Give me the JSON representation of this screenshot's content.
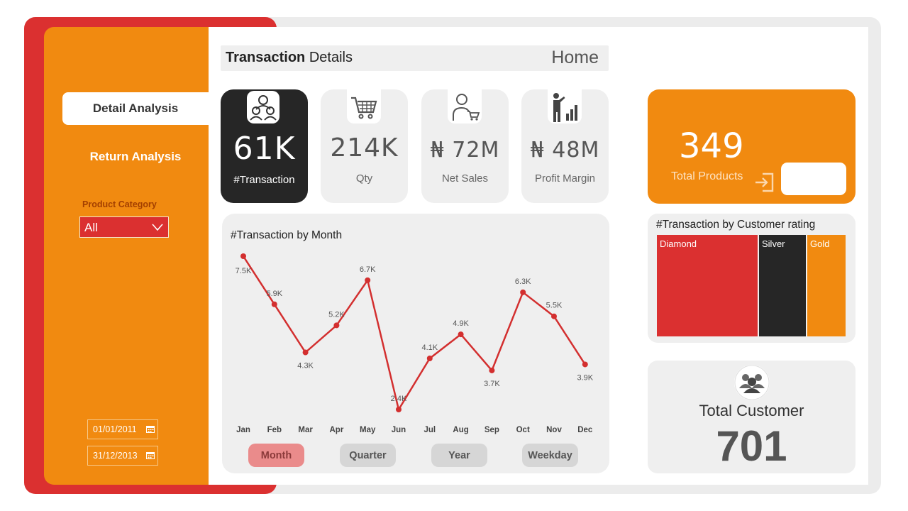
{
  "nav": {
    "detail_label": "Detail Analysis",
    "return_label": "Return Analysis"
  },
  "filter": {
    "label": "Product Category",
    "selected": "All"
  },
  "dates": {
    "start": "01/01/2011",
    "end": "31/12/2013"
  },
  "header": {
    "title_bold": "Transaction",
    "title_rest": " Details",
    "home_label": "Home"
  },
  "kpis": {
    "transactions": {
      "value": "61K",
      "label": "#Transaction",
      "icon": "group-users-icon"
    },
    "qty": {
      "value": "214K",
      "label": "Qty",
      "icon": "shopping-cart-icon"
    },
    "net_sales": {
      "value": "₦ 72M",
      "label": "Net Sales",
      "icon": "shopper-cart-icon"
    },
    "profit": {
      "value": "₦ 48M",
      "label": "Profit Margin",
      "icon": "presenter-bar-chart-icon"
    }
  },
  "chart_data": {
    "type": "line",
    "title": "#Transaction by Month",
    "categories": [
      "Jan",
      "Feb",
      "Mar",
      "Apr",
      "May",
      "Jun",
      "Jul",
      "Aug",
      "Sep",
      "Oct",
      "Nov",
      "Dec"
    ],
    "values": [
      7.5,
      5.9,
      4.3,
      5.2,
      6.7,
      2.4,
      4.1,
      4.9,
      3.7,
      6.3,
      5.5,
      3.9
    ],
    "data_labels": [
      "7.5K",
      "5.9K",
      "4.3K",
      "5.2K",
      "6.7K",
      "2.4K",
      "4.1K",
      "4.9K",
      "3.7K",
      "6.3K",
      "5.5K",
      "3.9K"
    ],
    "unit": "K",
    "color": "#d32f2f"
  },
  "period_buttons": {
    "month": "Month",
    "quarter": "Quarter",
    "year": "Year",
    "weekday": "Weekday"
  },
  "products": {
    "value": "349",
    "label": "Total Products"
  },
  "rating": {
    "title": "#Transaction by Customer rating",
    "segments": [
      {
        "name": "Diamond",
        "color": "#db3030"
      },
      {
        "name": "Silver",
        "color": "#262626"
      },
      {
        "name": "Gold",
        "color": "#f18a10"
      }
    ]
  },
  "customers": {
    "label": "Total Customer",
    "value": "701",
    "icon": "customers-group-icon"
  },
  "colors": {
    "red": "#db3030",
    "orange": "#f18a10",
    "dark": "#262626"
  }
}
